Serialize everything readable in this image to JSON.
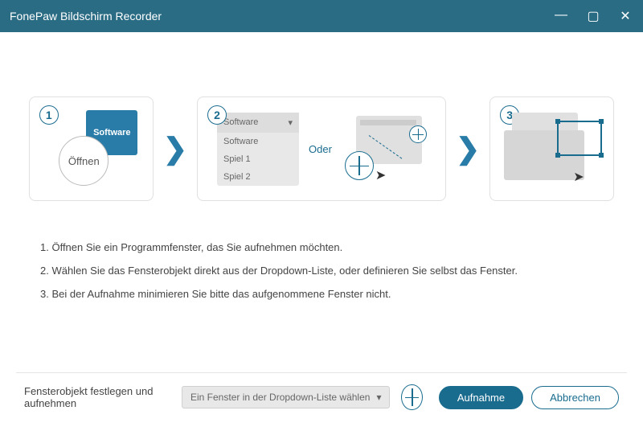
{
  "titlebar": {
    "title": "FonePaw Bildschirm Recorder"
  },
  "steps": {
    "step1": {
      "num": "1",
      "software": "Software",
      "open": "Öffnen"
    },
    "step2": {
      "num": "2",
      "dd_selected": "Software",
      "dd_items": [
        "Software",
        "Spiel 1",
        "Spiel 2"
      ],
      "oder": "Oder"
    },
    "step3": {
      "num": "3"
    }
  },
  "instructions": {
    "line1": "1. Öffnen Sie ein Programmfenster, das Sie aufnehmen möchten.",
    "line2": "2. Wählen Sie das Fensterobjekt direkt aus der Dropdown-Liste, oder definieren Sie selbst das Fenster.",
    "line3": "3. Bei der Aufnahme minimieren Sie bitte das aufgenommene Fenster nicht."
  },
  "bottom": {
    "label": "Fensterobjekt festlegen und aufnehmen",
    "dropdown_placeholder": "Ein Fenster in der Dropdown-Liste wählen",
    "record": "Aufnahme",
    "cancel": "Abbrechen"
  }
}
